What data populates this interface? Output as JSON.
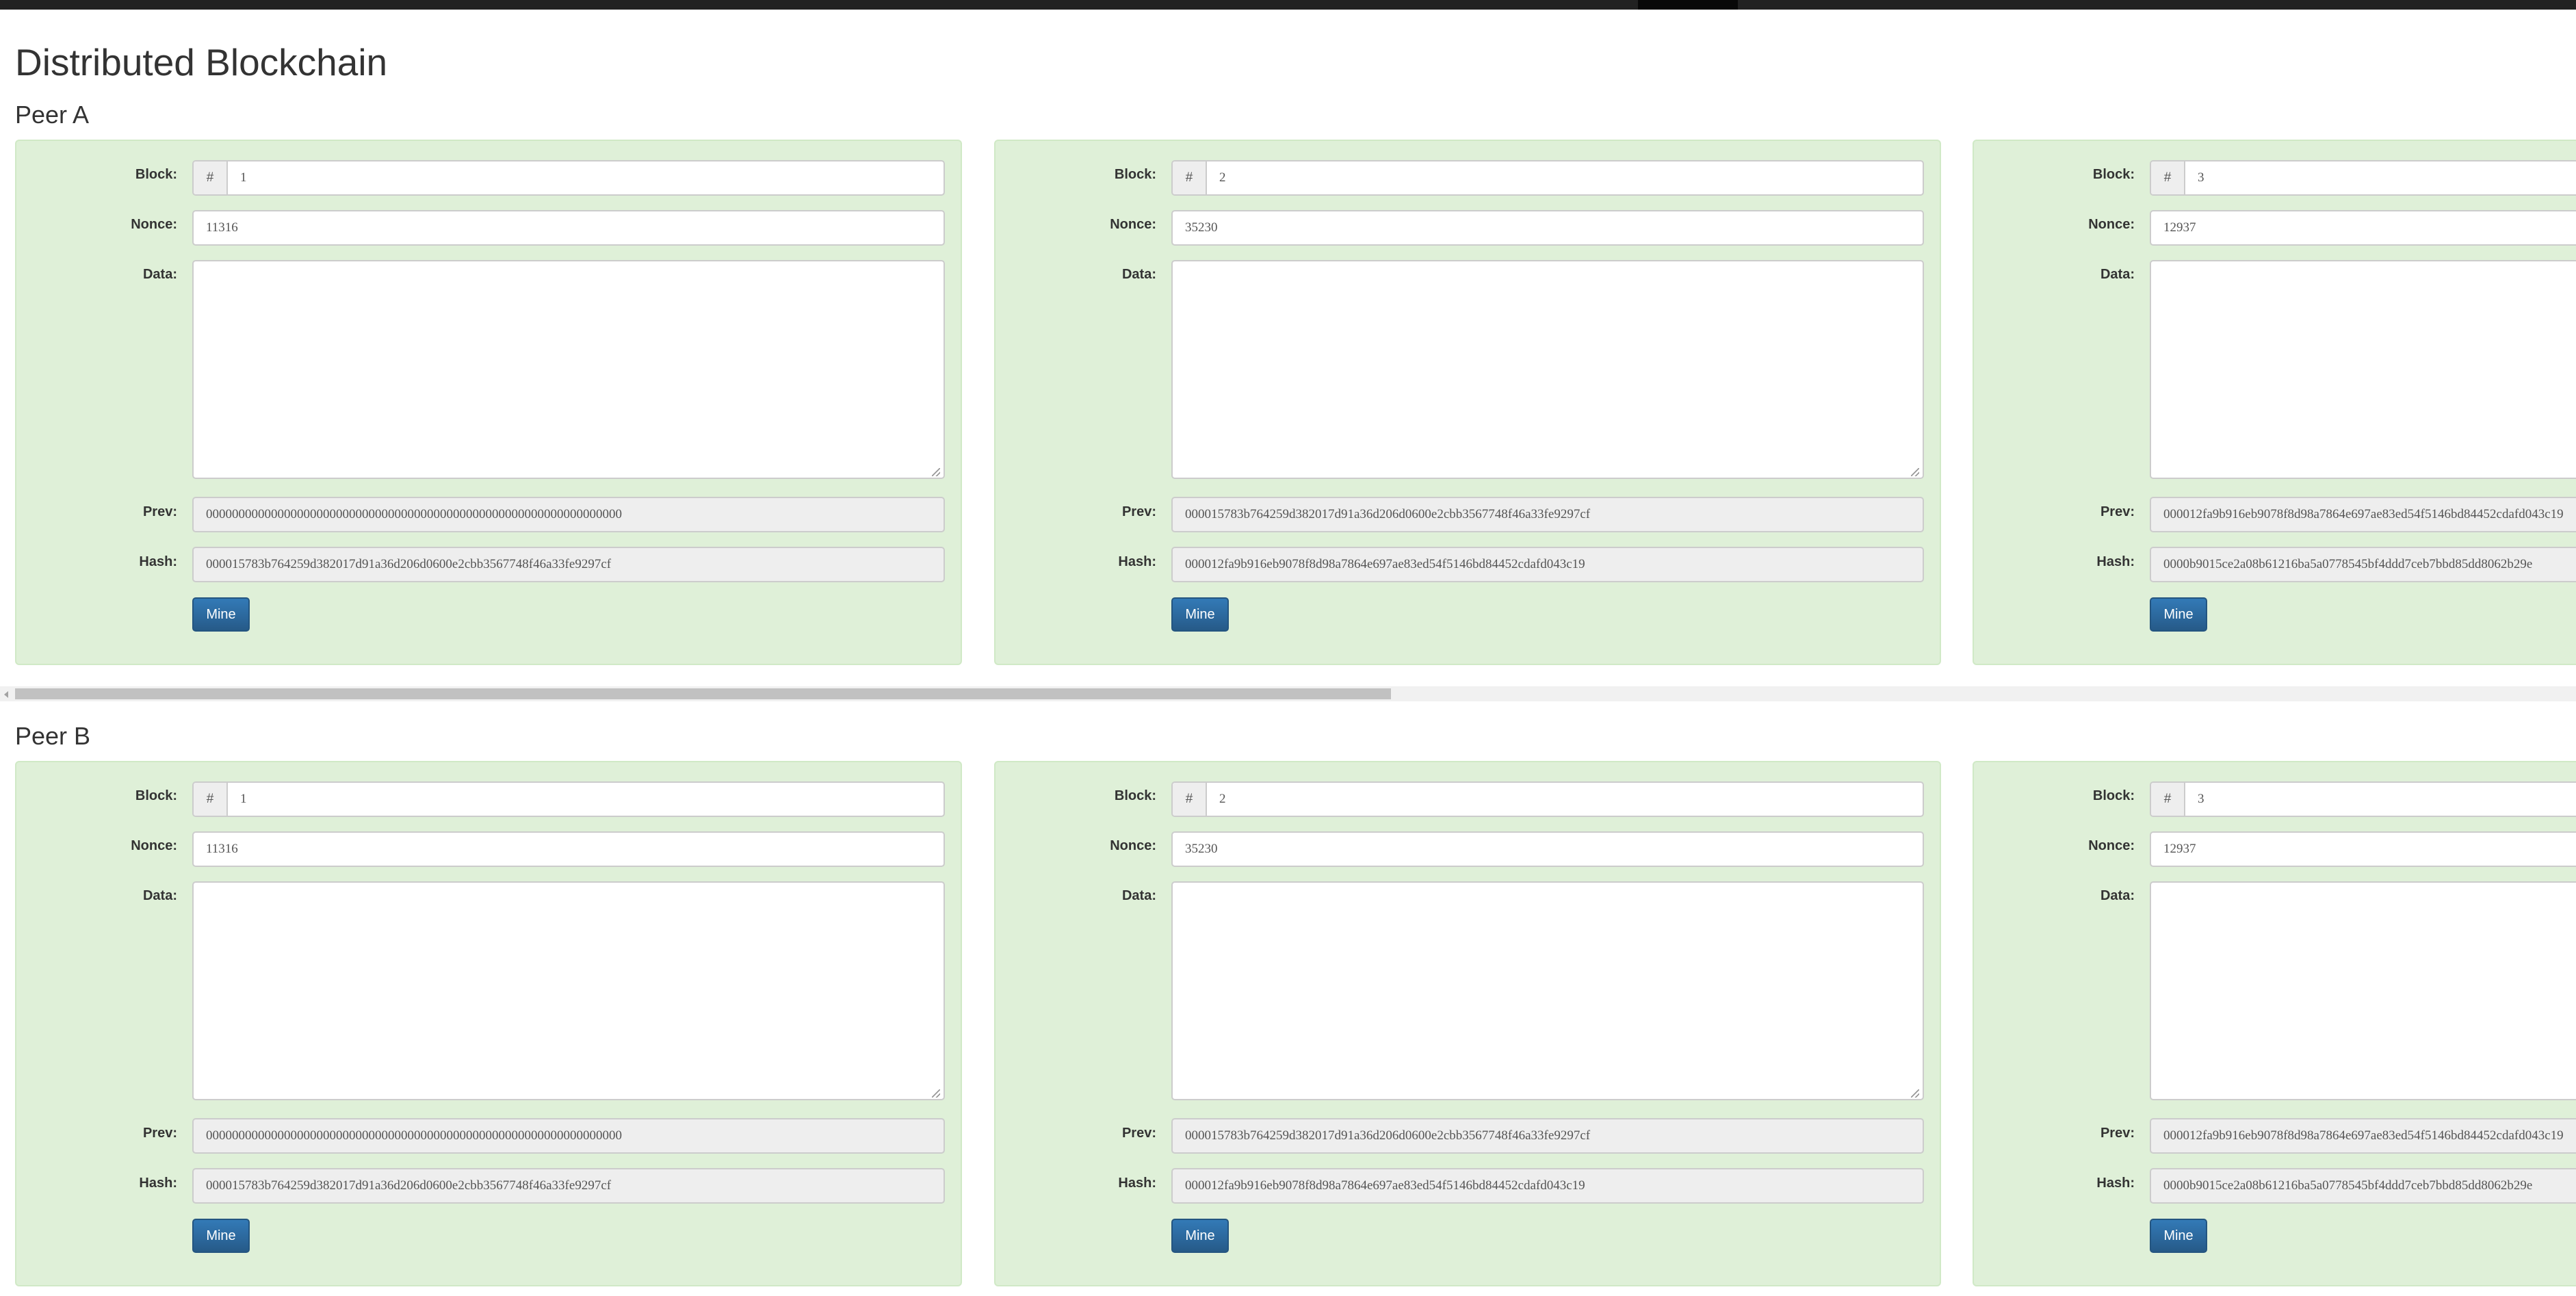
{
  "title": "Distributed Blockchain",
  "labels": {
    "block": "Block:",
    "nonce": "Nonce:",
    "data": "Data:",
    "prev": "Prev:",
    "hash": "Hash:",
    "addon": "#",
    "mine": "Mine"
  },
  "peers": [
    {
      "name": "Peer A",
      "blocks": [
        {
          "number": "1",
          "nonce": "11316",
          "data": "",
          "prev": "0000000000000000000000000000000000000000000000000000000000000000",
          "hash": "000015783b764259d382017d91a36d206d0600e2cbb3567748f46a33fe9297cf"
        },
        {
          "number": "2",
          "nonce": "35230",
          "data": "",
          "prev": "000015783b764259d382017d91a36d206d0600e2cbb3567748f46a33fe9297cf",
          "hash": "000012fa9b916eb9078f8d98a7864e697ae83ed54f5146bd84452cdafd043c19"
        },
        {
          "number": "3",
          "nonce": "12937",
          "data": "",
          "prev": "000012fa9b916eb9078f8d98a7864e697ae83ed54f5146bd84452cdafd043c19",
          "hash": "0000b9015ce2a08b61216ba5a0778545bf4ddd7ceb7bbd85dd8062b29e"
        }
      ]
    },
    {
      "name": "Peer B",
      "blocks": [
        {
          "number": "1",
          "nonce": "11316",
          "data": "",
          "prev": "0000000000000000000000000000000000000000000000000000000000000000",
          "hash": "000015783b764259d382017d91a36d206d0600e2cbb3567748f46a33fe9297cf"
        },
        {
          "number": "2",
          "nonce": "35230",
          "data": "",
          "prev": "000015783b764259d382017d91a36d206d0600e2cbb3567748f46a33fe9297cf",
          "hash": "000012fa9b916eb9078f8d98a7864e697ae83ed54f5146bd84452cdafd043c19"
        },
        {
          "number": "3",
          "nonce": "12937",
          "data": "",
          "prev": "000012fa9b916eb9078f8d98a7864e697ae83ed54f5146bd84452cdafd043c19",
          "hash": "0000b9015ce2a08b61216ba5a0778545bf4ddd7ceb7bbd85dd8062b29e"
        }
      ]
    }
  ]
}
